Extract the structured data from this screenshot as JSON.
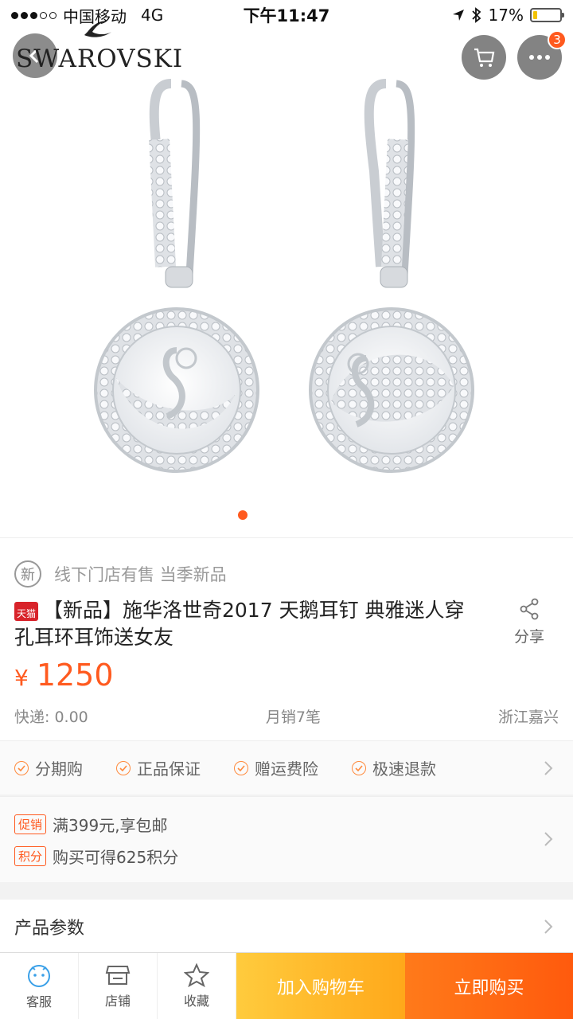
{
  "status_bar": {
    "carrier": "中国移动",
    "network": "4G",
    "time": "下午11:47",
    "battery_percent": "17%",
    "battery_level": 0.17
  },
  "header": {
    "brand": "SWAROVSKI",
    "cart_icon": "cart-icon",
    "more_icon": "more-icon",
    "more_badge": "3"
  },
  "gallery": {
    "current_index": 1,
    "total": 1
  },
  "product": {
    "tagline": "线下门店有售 当季新品",
    "new_badge": "新",
    "tmall_badge": "天猫",
    "title": "【新品】施华洛世奇2017 天鹅耳钉 典雅迷人穿孔耳环耳饰送女友",
    "share_label": "分享",
    "currency": "¥",
    "price": "1250",
    "shipping": "快递: 0.00",
    "monthly_sales": "月销7笔",
    "location": "浙江嘉兴"
  },
  "guarantees": [
    "分期购",
    "正品保证",
    "赠运费险",
    "极速退款"
  ],
  "promotions": [
    {
      "tag": "促销",
      "text": "满399元,享包邮"
    },
    {
      "tag": "积分",
      "text": "购买可得625积分"
    }
  ],
  "params": {
    "label": "产品参数"
  },
  "bottom_bar": {
    "service": "客服",
    "store": "店铺",
    "favorite": "收藏",
    "add_to_cart": "加入购物车",
    "buy_now": "立即购买"
  },
  "colors": {
    "accent": "#ff5a1f",
    "cart_button": "#ffb32a",
    "buy_button": "#ff6a14"
  }
}
